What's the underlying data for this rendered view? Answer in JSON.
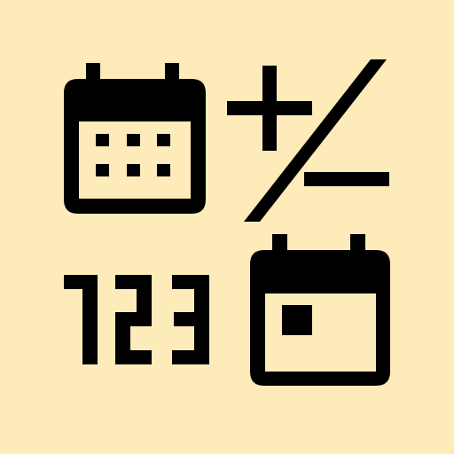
{
  "colors": {
    "background": "#FEEBBA",
    "ink": "#000000"
  },
  "icon": {
    "name": "date-calculator-icon",
    "parts": [
      "calendar-grid-icon",
      "plus-minus-icon",
      "numbers-123-icon",
      "calendar-day-icon"
    ],
    "numbers": "123"
  }
}
